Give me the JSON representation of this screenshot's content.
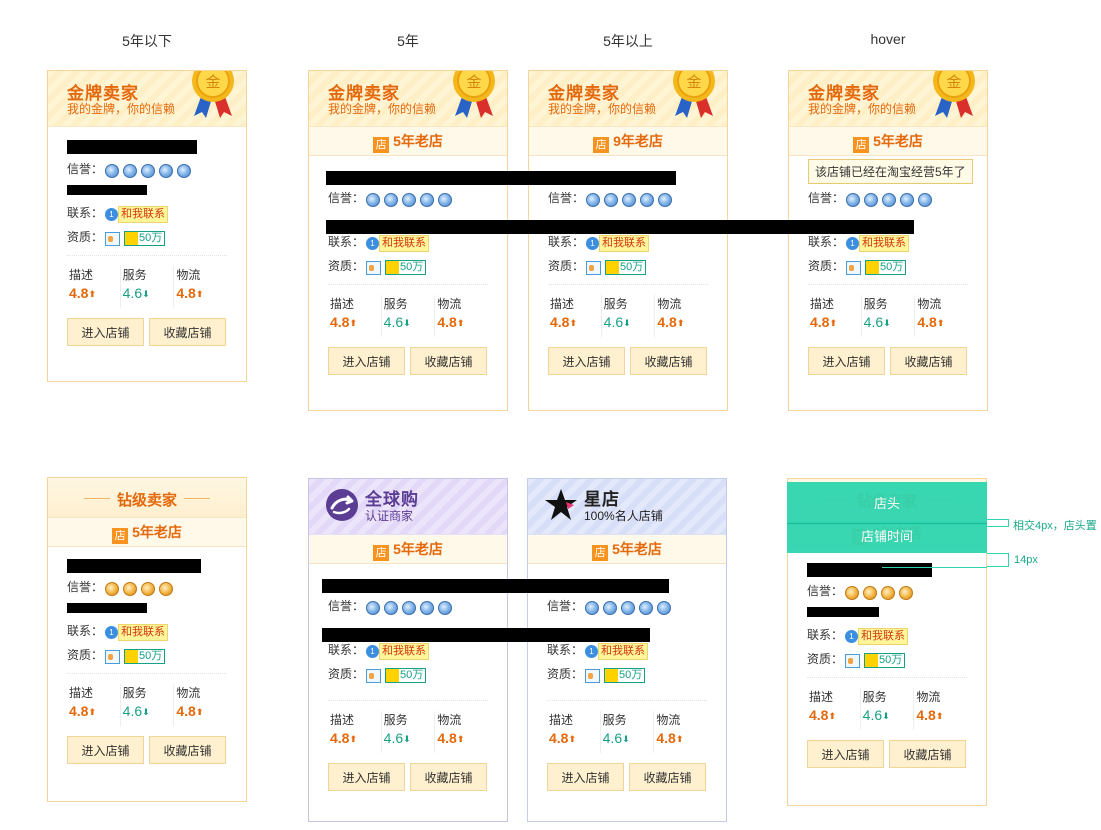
{
  "captions": [
    "5年以下",
    "5年",
    "5年以上",
    "hover"
  ],
  "gold": {
    "title": "金牌卖家",
    "subtitle": "我的金牌，你的信赖",
    "medal_char": "金"
  },
  "diamond": {
    "title": "钻级卖家"
  },
  "global": {
    "title": "全球购",
    "subtitle": "认证商家"
  },
  "star": {
    "title": "星店",
    "subtitle": "100%名人店铺"
  },
  "badge_char": "店",
  "age": {
    "five": "5年老店",
    "nine": "9年老店"
  },
  "labels": {
    "credit": "信誉：",
    "contact": "联系：",
    "qual": "资质："
  },
  "contact_text": "和我联系",
  "qual_amount": "50万",
  "scores": [
    {
      "label": "描述",
      "value": "4.8",
      "dir": "up",
      "color": "#e4690c"
    },
    {
      "label": "服务",
      "value": "4.6",
      "dir": "down",
      "color": "#16a085"
    },
    {
      "label": "物流",
      "value": "4.8",
      "dir": "up",
      "color": "#e4690c"
    }
  ],
  "buttons": {
    "enter": "进入店铺",
    "collect": "收藏店铺"
  },
  "tooltip": "该店铺已经在淘宝经营5年了",
  "annotation": {
    "head": "店头",
    "time": "店铺时间",
    "note1": "相交4px，店头置",
    "note2": "14px"
  },
  "colors": {
    "accent": "#e4690c",
    "green": "#16a085",
    "border": "#f6d59a",
    "annotation": "#2fd5b0"
  }
}
